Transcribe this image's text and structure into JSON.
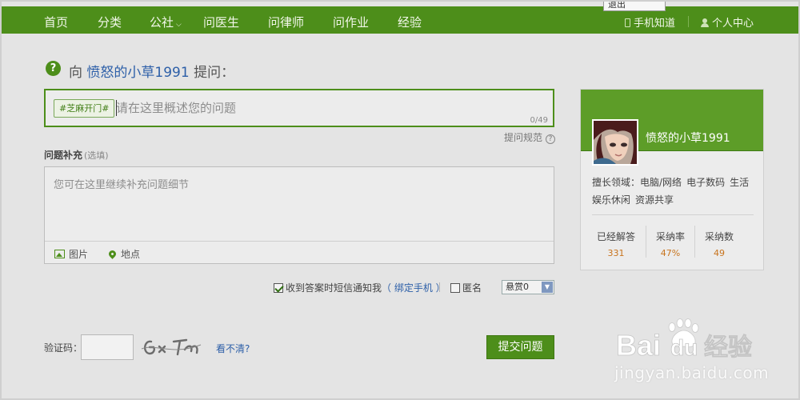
{
  "nav": {
    "items": [
      "首页",
      "分类",
      "公社",
      "问医生",
      "问律师",
      "问作业",
      "经验"
    ],
    "mobile_label": "手机知道",
    "user_center_label": "个人中心",
    "logout_label": "退出"
  },
  "ask": {
    "prefix": "向",
    "username": "愤怒的小草1991",
    "suffix": "提问：",
    "topic_tag": "#芝麻开门#",
    "question_placeholder": "请在这里概述您的问题",
    "char_count": "0/49",
    "rules_link": "提问规范"
  },
  "supplement": {
    "label": "问题补充",
    "optional": "(选填)",
    "placeholder": "您可在这里继续补充问题细节",
    "image_label": "图片",
    "location_label": "地点"
  },
  "options": {
    "sms_notify_label": "收到答案时短信通知我",
    "bind_phone_link": "（ 绑定手机 ）",
    "anonymous_label": "匿名",
    "reward_value": "悬赏0"
  },
  "captcha": {
    "label": "验证码：",
    "refresh_link": "看不清?",
    "submit_label": "提交问题"
  },
  "profile": {
    "name": "愤怒的小草1991",
    "expertise_label": "擅长领域：",
    "expertise": [
      "电脑/网络",
      "电子数码",
      "生活",
      "娱乐休闲",
      "资源共享"
    ],
    "stats": [
      {
        "label": "已经解答",
        "value": "331"
      },
      {
        "label": "采纳率",
        "value": "47%"
      },
      {
        "label": "采纳数",
        "value": "49"
      }
    ]
  },
  "watermark": {
    "url": "jingyan.baidu.com"
  },
  "colors": {
    "brand_green": "#4d8e1a",
    "link_blue": "#2d5fa8",
    "stat_orange": "#c8741e"
  }
}
